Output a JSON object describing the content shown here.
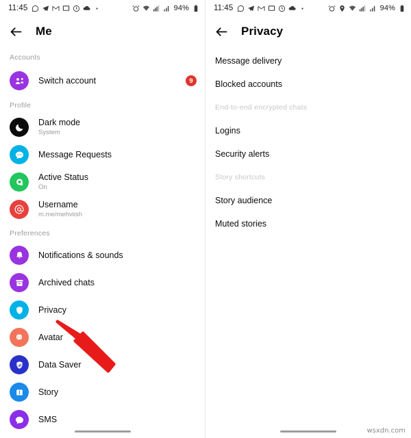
{
  "watermark": "wsxdn.com",
  "colors": {
    "badge_red": "#e0352b",
    "arrow_red": "#e81b1b",
    "purple": "#9a33e0",
    "cyan": "#00b2e6",
    "green": "#22c55e",
    "red": "#e8413c",
    "black": "#0c0c0c",
    "coral": "#f2745a",
    "navy": "#2a31c9",
    "blue": "#1b8ae8",
    "violet": "#8b2ee8"
  },
  "left_screen": {
    "status_bar": {
      "time": "11:45",
      "left_icons": [
        "whatsapp-icon",
        "telegram-icon",
        "mail-icon",
        "message-icon",
        "clock-icon",
        "cloud-icon",
        "dot-icon"
      ],
      "right_icons": [
        "alarm-icon",
        "wifi-icon",
        "signal-cell-1-icon",
        "signal-cell-2-icon"
      ],
      "battery": "94%"
    },
    "app_bar": {
      "back_icon": "back-arrow-icon",
      "title": "Me"
    },
    "sections": [
      {
        "label": "Accounts",
        "items": [
          {
            "title": "Switch account",
            "subtitle": "",
            "icon": "switch-account-icon",
            "color": "#9a33e0",
            "badge": "9"
          }
        ]
      },
      {
        "label": "Profile",
        "items": [
          {
            "title": "Dark mode",
            "subtitle": "System",
            "icon": "moon-icon",
            "color": "#0c0c0c",
            "badge": ""
          },
          {
            "title": "Message Requests",
            "subtitle": "",
            "icon": "message-bubble-icon",
            "color": "#00b2e6",
            "badge": ""
          },
          {
            "title": "Active Status",
            "subtitle": "On",
            "icon": "active-status-icon",
            "color": "#22c55e",
            "badge": ""
          },
          {
            "title": "Username",
            "subtitle": "m.me/mehviish",
            "icon": "at-sign-icon",
            "color": "#e8413c",
            "badge": ""
          }
        ]
      },
      {
        "label": "Preferences",
        "items": [
          {
            "title": "Notifications & sounds",
            "subtitle": "",
            "icon": "bell-icon",
            "color": "#9a33e0",
            "badge": ""
          },
          {
            "title": "Archived chats",
            "subtitle": "",
            "icon": "archive-box-icon",
            "color": "#9a33e0",
            "badge": ""
          },
          {
            "title": "Privacy",
            "subtitle": "",
            "icon": "shield-icon",
            "color": "#00b2e6",
            "badge": ""
          },
          {
            "title": "Avatar",
            "subtitle": "",
            "icon": "avatar-icon",
            "color": "#f2745a",
            "badge": ""
          },
          {
            "title": "Data Saver",
            "subtitle": "",
            "icon": "data-saver-shield-icon",
            "color": "#2a31c9",
            "badge": ""
          },
          {
            "title": "Story",
            "subtitle": "",
            "icon": "story-icon",
            "color": "#1b8ae8",
            "badge": ""
          },
          {
            "title": "SMS",
            "subtitle": "",
            "icon": "sms-icon",
            "color": "#8b2ee8",
            "badge": ""
          }
        ]
      }
    ],
    "annotation_arrow": "red-arrow-pointing-to-privacy"
  },
  "right_screen": {
    "status_bar": {
      "time": "11:45",
      "left_icons": [
        "whatsapp-icon",
        "telegram-icon",
        "mail-icon",
        "message-icon",
        "clock-icon",
        "cloud-icon",
        "dot-icon"
      ],
      "right_icons": [
        "alarm-icon",
        "location-pin-icon",
        "wifi-icon",
        "signal-cell-1-icon",
        "signal-cell-2-icon"
      ],
      "battery": "94%"
    },
    "app_bar": {
      "back_icon": "back-arrow-icon",
      "title": "Privacy"
    },
    "items": [
      {
        "label": "Message delivery",
        "type": "item"
      },
      {
        "label": "Blocked accounts",
        "type": "item"
      },
      {
        "label": "End-to-end encrypted chats",
        "type": "section"
      },
      {
        "label": "Logins",
        "type": "item"
      },
      {
        "label": "Security alerts",
        "type": "item"
      },
      {
        "label": "Story shortcuts",
        "type": "section"
      },
      {
        "label": "Story audience",
        "type": "item"
      },
      {
        "label": "Muted stories",
        "type": "item"
      }
    ],
    "annotation_arrow": "red-arrow-pointing-to-blocked-accounts"
  }
}
